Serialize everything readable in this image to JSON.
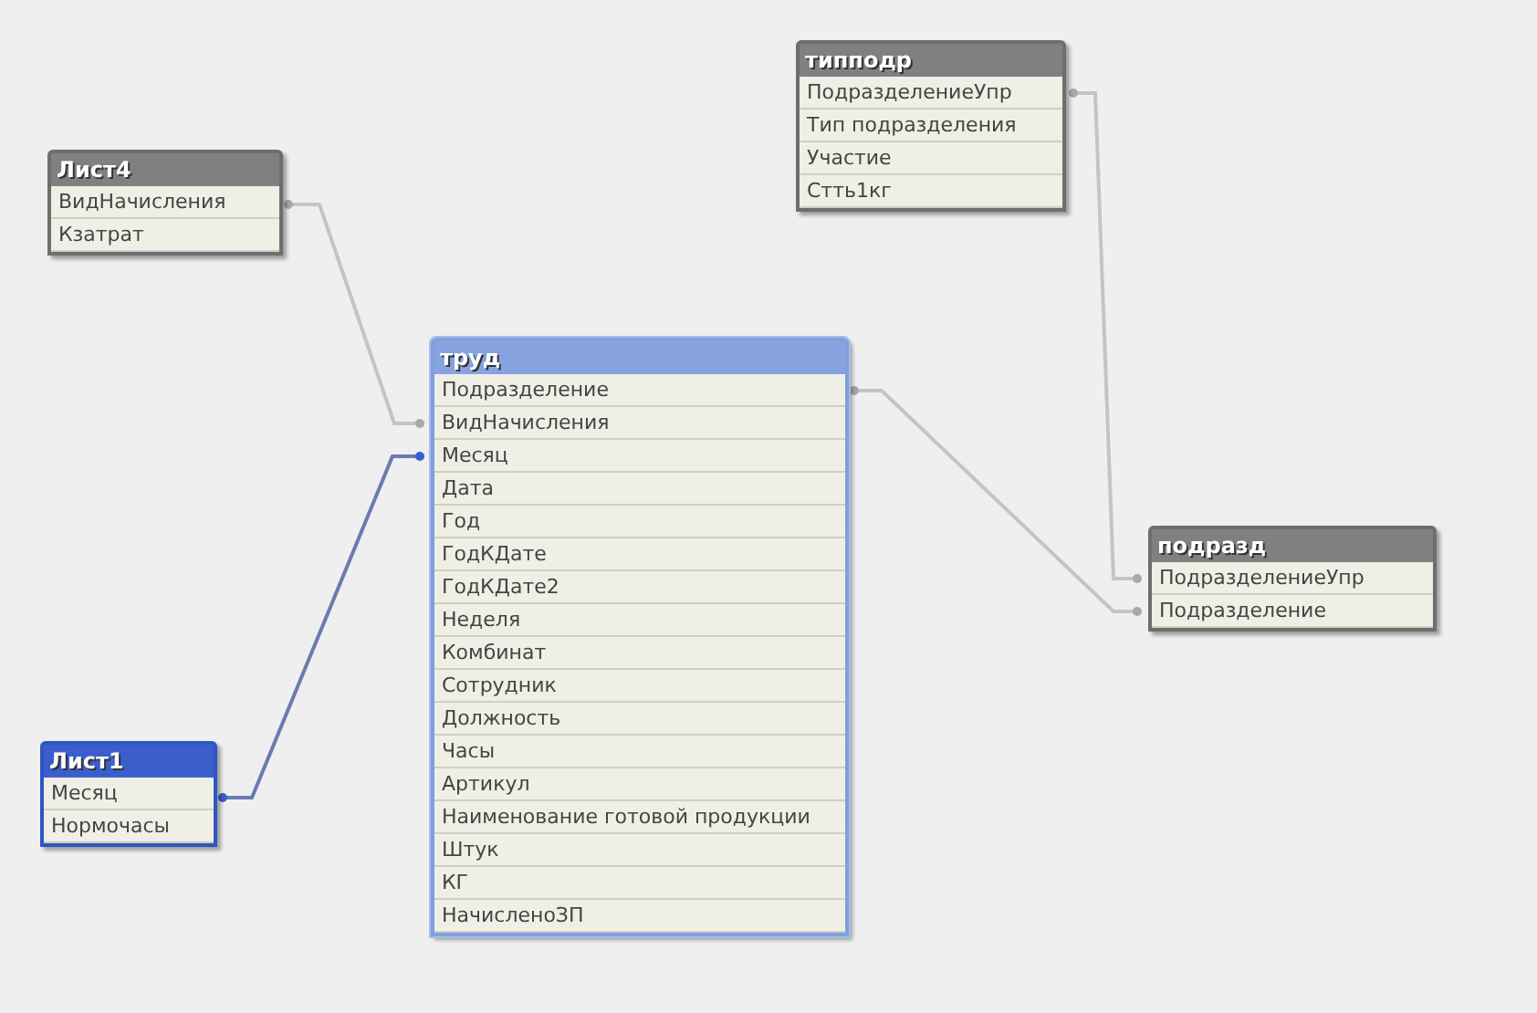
{
  "tables": [
    {
      "title": "типподр",
      "selected": false,
      "linked": false,
      "fields": [
        "ПодразделениеУпр",
        "Тип подразделения",
        "Участие",
        "Стть1кг"
      ]
    },
    {
      "title": "Лист4",
      "selected": false,
      "linked": false,
      "fields": [
        "ВидНачисления",
        "Кзатрат"
      ]
    },
    {
      "title": "труд",
      "selected": false,
      "linked": true,
      "fields": [
        "Подразделение",
        "ВидНачисления",
        "Месяц",
        "Дата",
        "Год",
        "ГодКДате",
        "ГодКДате2",
        "Неделя",
        "Комбинат",
        "Сотрудник",
        "Должность",
        "Часы",
        "Артикул",
        "Наименование готовой продукции",
        "Штук",
        "КГ",
        "НачисленоЗП"
      ]
    },
    {
      "title": "Лист1",
      "selected": true,
      "linked": false,
      "fields": [
        "Месяц",
        "Нормочасы"
      ]
    },
    {
      "title": "подразд",
      "selected": false,
      "linked": false,
      "fields": [
        "ПодразделениеУпр",
        "Подразделение"
      ]
    }
  ],
  "links": [
    {
      "highlighted": false
    },
    {
      "highlighted": true
    },
    {
      "highlighted": false
    },
    {
      "highlighted": false
    }
  ]
}
